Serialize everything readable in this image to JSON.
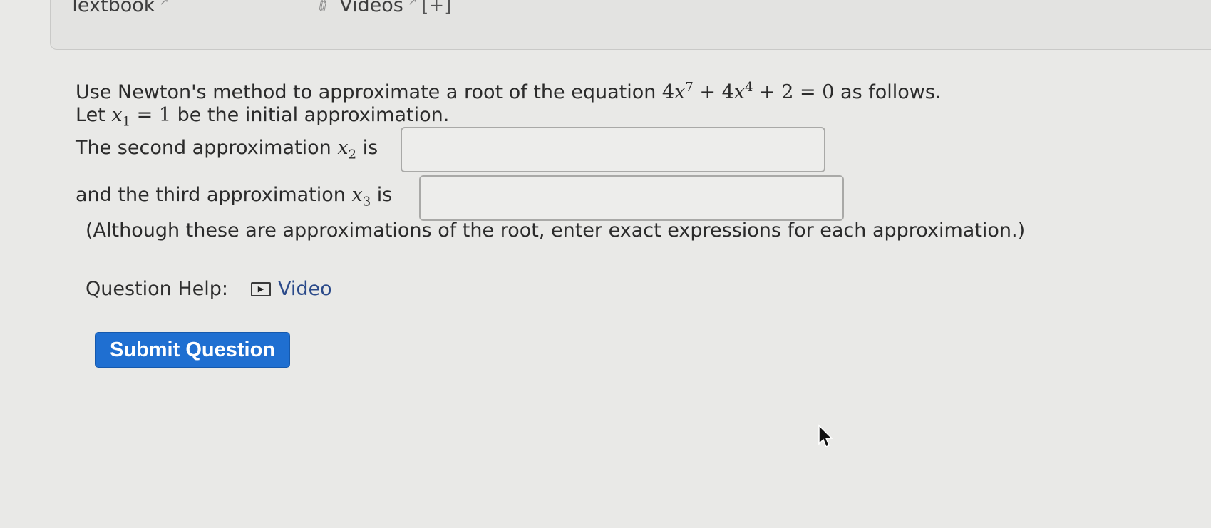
{
  "top_bar": {
    "textbook_label": "Textbook",
    "videos_label": "Videos",
    "expand_label": "[+]"
  },
  "question": {
    "line1_prefix": "Use Newton's method to approximate a root of the equation ",
    "equation": {
      "t1_coef": "4",
      "t1_var": "x",
      "t1_exp": "7",
      "plus1": " + ",
      "t2_coef": "4",
      "t2_var": "x",
      "t2_exp": "4",
      "plus2": " + ",
      "const": "2",
      "equals": " = ",
      "rhs": "0"
    },
    "line1_suffix": " as follows.",
    "line2_prefix": "Let ",
    "x1_var": "x",
    "x1_sub": "1",
    "x1_rest": " = 1",
    "line2_suffix": " be the initial approximation.",
    "second_prefix": "The second approximation ",
    "x2_var": "x",
    "x2_sub": "2",
    "second_suffix": " is",
    "third_prefix": "and the third approximation ",
    "x3_var": "x",
    "x3_sub": "3",
    "third_suffix": " is",
    "note": "(Although these are approximations of the root, enter exact expressions for each approximation.)"
  },
  "inputs": {
    "second_value": "",
    "third_value": ""
  },
  "help": {
    "label": "Question Help:",
    "video_label": "Video"
  },
  "submit_label": "Submit Question",
  "colors": {
    "accent": "#1f6fd1",
    "background": "#e9e9e7"
  }
}
